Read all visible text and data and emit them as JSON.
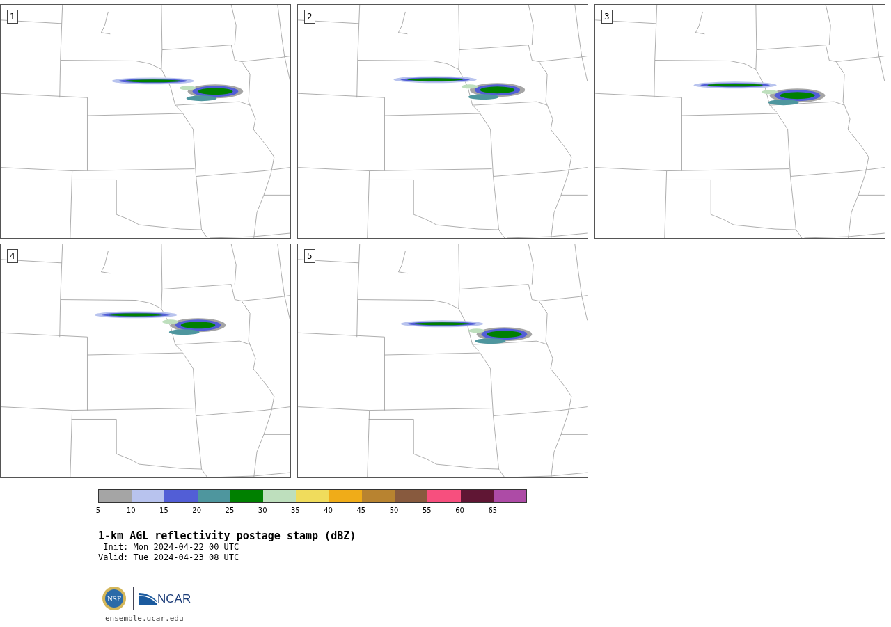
{
  "panels": [
    {
      "label": "1"
    },
    {
      "label": "2"
    },
    {
      "label": "3"
    },
    {
      "label": "4"
    },
    {
      "label": "5"
    }
  ],
  "colorbar": {
    "bins": [
      {
        "color": "#a5a5a5"
      },
      {
        "color": "#b8c3ee"
      },
      {
        "color": "#525ed6"
      },
      {
        "color": "#4e969e"
      },
      {
        "color": "#008000"
      },
      {
        "color": "#bedfbd"
      },
      {
        "color": "#f0dc5c"
      },
      {
        "color": "#f0ac18"
      },
      {
        "color": "#b88330"
      },
      {
        "color": "#885a3e"
      },
      {
        "color": "#f74f7e"
      },
      {
        "color": "#601634"
      },
      {
        "color": "#ad4ba6"
      }
    ],
    "ticks": [
      "5",
      "10",
      "15",
      "20",
      "25",
      "30",
      "35",
      "40",
      "45",
      "50",
      "55",
      "60",
      "65"
    ]
  },
  "title": "1-km AGL reflectivity postage stamp (dBZ)",
  "init": " Init: Mon 2024-04-22 00 UTC",
  "valid": "Valid: Tue 2024-04-23 08 UTC",
  "logos": {
    "nsf": "NSF",
    "ncar": "NCAR"
  },
  "footer": "ensemble.ucar.edu"
}
